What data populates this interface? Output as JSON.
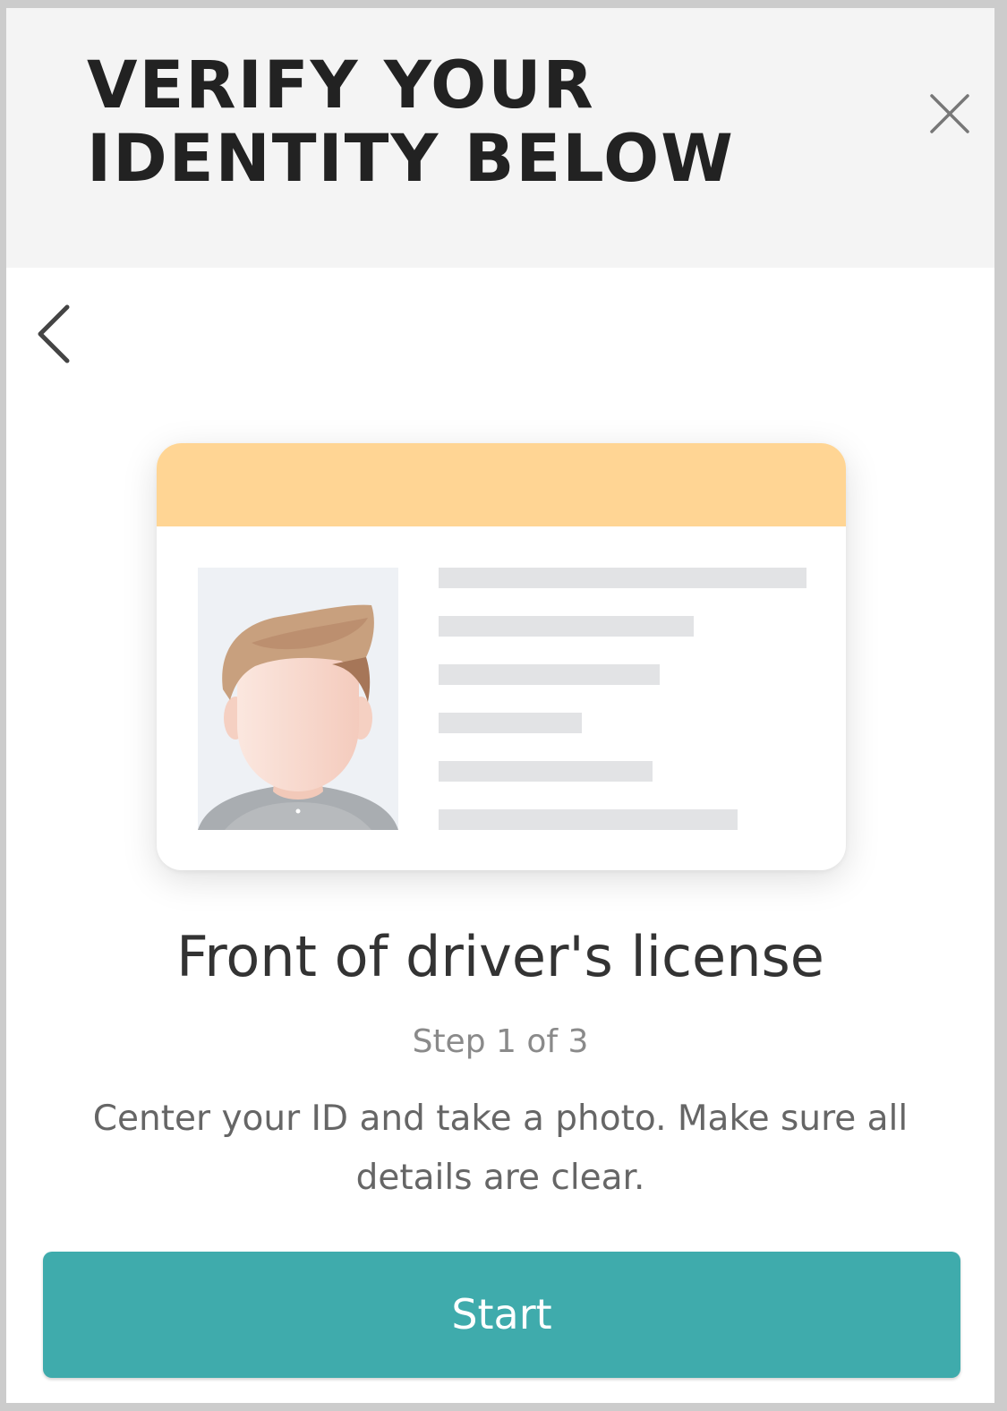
{
  "header": {
    "title": "VERIFY YOUR IDENTITY BELOW",
    "background": "#f4f4f4"
  },
  "icons": {
    "close": "close-icon",
    "back": "chevron-left-icon"
  },
  "illustration": {
    "name": "drivers-license-illustration",
    "band_color": "#ffd594",
    "line_color": "#e2e3e5",
    "text_line_count": 6
  },
  "main": {
    "title": "Front of driver's license",
    "step": "Step 1 of 3",
    "instructions": "Center your ID and take a photo. Make sure all details are clear."
  },
  "actions": {
    "start_label": "Start",
    "start_color": "#3fabac"
  }
}
